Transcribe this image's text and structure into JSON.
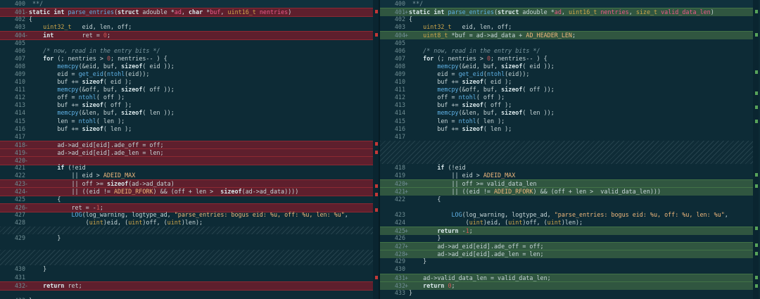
{
  "colors": {
    "keyword": "#d8e7ea",
    "type": "#cda54a",
    "func": "#5fb1e4",
    "param": "#ec5a8a",
    "comment": "#7c98a0",
    "number": "#cf5757",
    "string": "#f0b87c",
    "macro": "#f0b87c",
    "text": "#c7d6d8"
  },
  "left": [
    {
      "n": "400",
      "m": " ",
      "bg": "hdr",
      "code": " **/"
    },
    {
      "n": "401",
      "m": "-",
      "bg": "del",
      "code": "static int parse_entries(struct adouble *ad, char *buf, uint16_t nentries)"
    },
    {
      "n": "402",
      "m": " ",
      "bg": "plain",
      "code": "{"
    },
    {
      "n": "403",
      "m": " ",
      "bg": "plain",
      "code": "    uint32_t   eid, len, off;"
    },
    {
      "n": "404",
      "m": "-",
      "bg": "del",
      "code": "    int        ret = 0;"
    },
    {
      "n": "405",
      "m": " ",
      "bg": "plain",
      "code": ""
    },
    {
      "n": "406",
      "m": " ",
      "bg": "plain",
      "code": "    /* now, read in the entry bits */"
    },
    {
      "n": "407",
      "m": " ",
      "bg": "plain",
      "code": "    for (; nentries > 0; nentries-- ) {"
    },
    {
      "n": "408",
      "m": " ",
      "bg": "plain",
      "code": "        memcpy(&eid, buf, sizeof( eid ));"
    },
    {
      "n": "409",
      "m": " ",
      "bg": "plain",
      "code": "        eid = get_eid(ntohl(eid));"
    },
    {
      "n": "410",
      "m": " ",
      "bg": "plain",
      "code": "        buf += sizeof( eid );"
    },
    {
      "n": "411",
      "m": " ",
      "bg": "plain",
      "code": "        memcpy(&off, buf, sizeof( off ));"
    },
    {
      "n": "412",
      "m": " ",
      "bg": "plain",
      "code": "        off = ntohl( off );"
    },
    {
      "n": "413",
      "m": " ",
      "bg": "plain",
      "code": "        buf += sizeof( off );"
    },
    {
      "n": "414",
      "m": " ",
      "bg": "plain",
      "code": "        memcpy(&len, buf, sizeof( len ));"
    },
    {
      "n": "415",
      "m": " ",
      "bg": "plain",
      "code": "        len = ntohl( len );"
    },
    {
      "n": "416",
      "m": " ",
      "bg": "plain",
      "code": "        buf += sizeof( len );"
    },
    {
      "n": "417",
      "m": " ",
      "bg": "plain",
      "code": ""
    },
    {
      "n": "418",
      "m": "-",
      "bg": "del",
      "code": "        ad->ad_eid[eid].ade_off = off;"
    },
    {
      "n": "419",
      "m": "-",
      "bg": "del",
      "code": "        ad->ad_eid[eid].ade_len = len;"
    },
    {
      "n": "420",
      "m": "-",
      "bg": "del",
      "code": ""
    },
    {
      "n": "421",
      "m": " ",
      "bg": "plain",
      "code": "        if (!eid"
    },
    {
      "n": "422",
      "m": " ",
      "bg": "plain",
      "code": "            || eid > ADEID_MAX"
    },
    {
      "n": "423",
      "m": "-",
      "bg": "del",
      "code": "            || off >= sizeof(ad->ad_data)"
    },
    {
      "n": "424",
      "m": "-",
      "bg": "del",
      "code": "            || ((eid != ADEID_RFORK) && (off + len >  sizeof(ad->ad_data))))"
    },
    {
      "n": "425",
      "m": " ",
      "bg": "plain",
      "code": "        {"
    },
    {
      "n": "426",
      "m": "-",
      "bg": "del",
      "code": "            ret = -1;"
    },
    {
      "n": "427",
      "m": " ",
      "bg": "plain",
      "code": "            LOG(log_warning, logtype_ad, \"parse_entries: bogus eid: %u, off: %u, len: %u\","
    },
    {
      "n": "428",
      "m": " ",
      "bg": "plain",
      "code": "                (uint)eid, (uint)off, (uint)len);"
    },
    {
      "n": "",
      "m": " ",
      "bg": "filler",
      "code": ""
    },
    {
      "n": "429",
      "m": " ",
      "bg": "plain",
      "code": "        }",
      "h": 2
    },
    {
      "n": "",
      "m": " ",
      "bg": "filler",
      "code": "",
      "h": 2
    },
    {
      "n": "430",
      "m": " ",
      "bg": "plain",
      "code": "    }"
    },
    {
      "n": "431",
      "m": " ",
      "bg": "plain",
      "code": ""
    },
    {
      "n": "432",
      "m": "-",
      "bg": "del",
      "code": "    return ret;"
    },
    {
      "n": "",
      "m": " ",
      "bg": "plain",
      "code": ""
    },
    {
      "n": "433",
      "m": " ",
      "bg": "plain",
      "code": "}"
    }
  ],
  "right": [
    {
      "n": "400",
      "m": " ",
      "bg": "hdr",
      "code": " **/"
    },
    {
      "n": "401",
      "m": "+",
      "bg": "add",
      "code": "static int parse_entries(struct adouble *ad, uint16_t nentries, size_t valid_data_len)"
    },
    {
      "n": "402",
      "m": " ",
      "bg": "plain",
      "code": "{"
    },
    {
      "n": "403",
      "m": " ",
      "bg": "plain",
      "code": "    uint32_t   eid, len, off;"
    },
    {
      "n": "404",
      "m": "+",
      "bg": "add",
      "code": "    uint8_t *buf = ad->ad_data + AD_HEADER_LEN;"
    },
    {
      "n": "405",
      "m": " ",
      "bg": "plain",
      "code": ""
    },
    {
      "n": "406",
      "m": " ",
      "bg": "plain",
      "code": "    /* now, read in the entry bits */"
    },
    {
      "n": "407",
      "m": " ",
      "bg": "plain",
      "code": "    for (; nentries > 0; nentries-- ) {"
    },
    {
      "n": "408",
      "m": " ",
      "bg": "plain",
      "code": "        memcpy(&eid, buf, sizeof( eid ));"
    },
    {
      "n": "409",
      "m": " ",
      "bg": "plain",
      "code": "        eid = get_eid(ntohl(eid));"
    },
    {
      "n": "410",
      "m": " ",
      "bg": "plain",
      "code": "        buf += sizeof( eid );"
    },
    {
      "n": "411",
      "m": " ",
      "bg": "plain",
      "code": "        memcpy(&off, buf, sizeof( off ));"
    },
    {
      "n": "412",
      "m": " ",
      "bg": "plain",
      "code": "        off = ntohl( off );"
    },
    {
      "n": "413",
      "m": " ",
      "bg": "plain",
      "code": "        buf += sizeof( off );"
    },
    {
      "n": "414",
      "m": " ",
      "bg": "plain",
      "code": "        memcpy(&len, buf, sizeof( len ));"
    },
    {
      "n": "415",
      "m": " ",
      "bg": "plain",
      "code": "        len = ntohl( len );"
    },
    {
      "n": "416",
      "m": " ",
      "bg": "plain",
      "code": "        buf += sizeof( len );"
    },
    {
      "n": "417",
      "m": " ",
      "bg": "plain",
      "code": ""
    },
    {
      "n": "",
      "m": " ",
      "bg": "filler",
      "code": "",
      "h": 3
    },
    {
      "n": "418",
      "m": " ",
      "bg": "plain",
      "code": "        if (!eid"
    },
    {
      "n": "419",
      "m": " ",
      "bg": "plain",
      "code": "            || eid > ADEID_MAX"
    },
    {
      "n": "420",
      "m": "+",
      "bg": "add",
      "code": "            || off >= valid_data_len"
    },
    {
      "n": "421",
      "m": "+",
      "bg": "add",
      "code": "            || ((eid != ADEID_RFORK) && (off + len >  valid_data_len)))"
    },
    {
      "n": "422",
      "m": " ",
      "bg": "plain",
      "code": "        {"
    },
    {
      "n": "",
      "m": " ",
      "bg": "plain",
      "code": ""
    },
    {
      "n": "423",
      "m": " ",
      "bg": "plain",
      "code": "            LOG(log_warning, logtype_ad, \"parse_entries: bogus eid: %u, off: %u, len: %u\","
    },
    {
      "n": "424",
      "m": " ",
      "bg": "plain",
      "code": "                (uint)eid, (uint)off, (uint)len);"
    },
    {
      "n": "425",
      "m": "+",
      "bg": "add",
      "code": "        return -1;"
    },
    {
      "n": "426",
      "m": " ",
      "bg": "plain",
      "code": "        }"
    },
    {
      "n": "427",
      "m": "+",
      "bg": "add",
      "code": "        ad->ad_eid[eid].ade_off = off;"
    },
    {
      "n": "428",
      "m": "+",
      "bg": "add",
      "code": "        ad->ad_eid[eid].ade_len = len;"
    },
    {
      "n": "429",
      "m": " ",
      "bg": "plain",
      "code": "    }"
    },
    {
      "n": "430",
      "m": " ",
      "bg": "plain",
      "code": ""
    },
    {
      "n": "431",
      "m": "+",
      "bg": "add",
      "code": "    ad->valid_data_len = valid_data_len;"
    },
    {
      "n": "432",
      "m": "+",
      "bg": "add",
      "code": "    return 0;"
    },
    {
      "n": "433",
      "m": " ",
      "bg": "plain",
      "code": "}"
    }
  ]
}
